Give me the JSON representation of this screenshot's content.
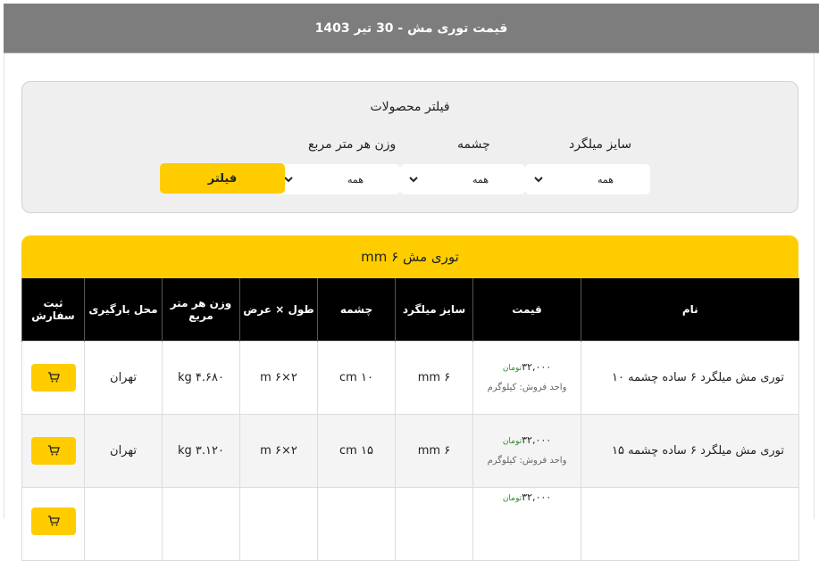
{
  "header": {
    "title": "قیمت توری مش - 30 تیر 1403"
  },
  "filter": {
    "title": "فیلتر محصولات",
    "fields": [
      {
        "label": "سایز میلگرد",
        "value": "همه"
      },
      {
        "label": "چشمه",
        "value": "همه"
      },
      {
        "label": "وزن هر متر مربع",
        "value": "همه"
      }
    ],
    "button_label": "فیلتر"
  },
  "product_group": {
    "title": "توری مش  ۶ mm",
    "columns": [
      "نام",
      "قیمت",
      "سایز میلگرد",
      "چشمه",
      "طول × عرض",
      "وزن هر متر مربع",
      "محل بارگیری",
      "ثبت سفارش"
    ],
    "rows": [
      {
        "name": "توری مش میلگرد ۶ ساده چشمه ۱۰",
        "price": "۳۲,۰۰۰",
        "currency": "تومان",
        "unit": "واحد فروش: کیلوگرم",
        "rebar_size": "۶ mm",
        "mesh": "۱۰ cm",
        "dimensions": "۲×۶ m",
        "weight": "۴.۶۸۰ kg",
        "location": "تهران"
      },
      {
        "name": "توری مش میلگرد ۶ ساده چشمه ۱۵",
        "price": "۳۲,۰۰۰",
        "currency": "تومان",
        "unit": "واحد فروش: کیلوگرم",
        "rebar_size": "۶ mm",
        "mesh": "۱۵ cm",
        "dimensions": "۲×۶ m",
        "weight": "۳.۱۲۰ kg",
        "location": "تهران"
      },
      {
        "name": "",
        "price": "۳۲,۰۰۰",
        "currency": "تومان",
        "unit": "",
        "rebar_size": "",
        "mesh": "",
        "dimensions": "",
        "weight": "",
        "location": ""
      }
    ]
  },
  "icons": {
    "chevron": "chevron-down-icon",
    "cart": "cart-icon"
  },
  "colors": {
    "accent": "#ffcc00",
    "header_bg": "#7d7d7d",
    "table_head": "#000000",
    "currency": "#2e8b2e"
  }
}
